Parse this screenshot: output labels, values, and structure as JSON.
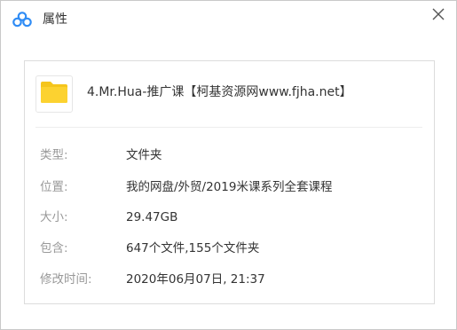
{
  "window": {
    "title": "属性",
    "close_icon": "close-icon",
    "logo_icon": "app-logo-icon"
  },
  "file": {
    "icon": "folder-icon",
    "folder_color": "#f5c51c",
    "name": "4.Mr.Hua-推广课【柯基资源网www.fjha.net】"
  },
  "properties": [
    {
      "label": "类型:",
      "value": "文件夹"
    },
    {
      "label": "位置:",
      "value": "我的网盘/外贸/2019米课系列全套课程"
    },
    {
      "label": "大小:",
      "value": "29.47GB"
    },
    {
      "label": "包含:",
      "value": "647个文件,155个文件夹"
    },
    {
      "label": "修改时间:",
      "value": "2020年06月07日, 21:37"
    }
  ],
  "colors": {
    "logo_blue": "#2f8cf5",
    "label_gray": "#999999",
    "text_dark": "#333333"
  }
}
